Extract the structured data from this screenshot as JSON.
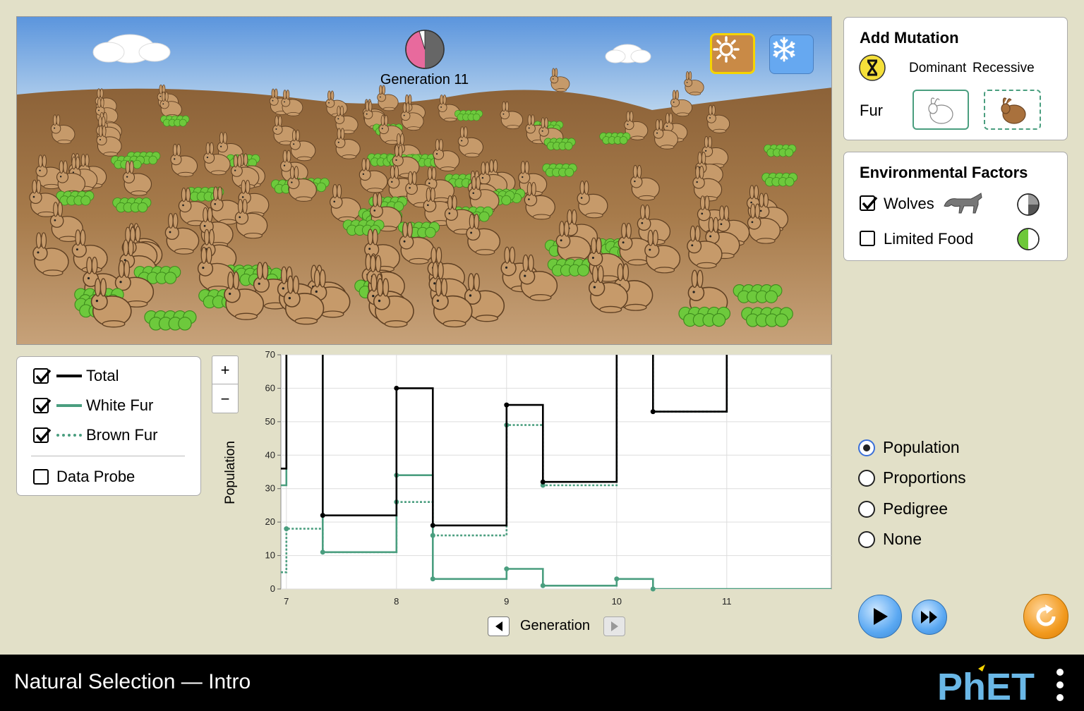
{
  "scene": {
    "generation_label": "Generation 11",
    "pie": {
      "white_fur_fraction": 0.04,
      "brown_fur_fraction": 0.66,
      "wolves_fraction": 0.3
    },
    "environment_buttons": {
      "equator": "sun-icon",
      "arctic": "snowflake-icon",
      "selected": "equator"
    },
    "colors": {
      "sky": "#5b95dd",
      "ground": "#a87a4e",
      "bunny_brown": "#c69a6a",
      "shrub": "#6dc93c",
      "pie_pink": "#e86a9d",
      "pie_gray": "#666666"
    }
  },
  "add_mutation": {
    "title": "Add Mutation",
    "dominant_label": "Dominant",
    "recessive_label": "Recessive",
    "trait_label": "Fur",
    "dominant_option": "white-bunny-icon",
    "recessive_option": "brown-bunny-icon",
    "icon": "dna-hourglass-icon"
  },
  "environmental_factors": {
    "title": "Environmental Factors",
    "wolves_label": "Wolves",
    "wolves_checked": true,
    "limited_food_label": "Limited Food",
    "limited_food_checked": false
  },
  "legend": {
    "total_label": "Total",
    "white_fur_label": "White Fur",
    "brown_fur_label": "Brown Fur",
    "data_probe_label": "Data Probe",
    "total_checked": true,
    "white_checked": true,
    "brown_checked": true,
    "data_probe_checked": false,
    "colors": {
      "total": "#000000",
      "white": "#4a9e7f",
      "brown": "#4a9e7f"
    }
  },
  "zoom": {
    "plus_label": "+",
    "minus_label": "−"
  },
  "graph": {
    "ylabel": "Population",
    "xlabel": "Generation"
  },
  "chart_data": {
    "type": "line",
    "xlabel": "Generation",
    "ylabel": "Population",
    "xlim": [
      6.95,
      11.95
    ],
    "ylim": [
      0,
      70
    ],
    "x_ticks": [
      7,
      8,
      9,
      10,
      11
    ],
    "y_ticks": [
      0,
      10,
      20,
      30,
      40,
      50,
      60,
      70
    ],
    "series": [
      {
        "name": "Total",
        "style": "solid",
        "color": "#000000",
        "points": [
          [
            6.95,
            36
          ],
          [
            7,
            36
          ],
          [
            7,
            80
          ],
          [
            7.33,
            80
          ],
          [
            7.33,
            22
          ],
          [
            8,
            22
          ],
          [
            8,
            60
          ],
          [
            8.33,
            60
          ],
          [
            8.33,
            19
          ],
          [
            9,
            19
          ],
          [
            9,
            55
          ],
          [
            9.33,
            55
          ],
          [
            9.33,
            32
          ],
          [
            10,
            32
          ],
          [
            10,
            80
          ],
          [
            10.33,
            80
          ],
          [
            10.33,
            53
          ],
          [
            11,
            53
          ],
          [
            11,
            80
          ]
        ],
        "markers": [
          [
            7.33,
            22
          ],
          [
            8,
            60
          ],
          [
            8.33,
            19
          ],
          [
            9,
            55
          ],
          [
            9.33,
            32
          ],
          [
            10.33,
            53
          ]
        ]
      },
      {
        "name": "White Fur",
        "style": "solid",
        "color": "#4a9e7f",
        "points": [
          [
            6.95,
            31
          ],
          [
            7,
            31
          ],
          [
            7,
            80
          ],
          [
            7.33,
            80
          ],
          [
            7.33,
            11
          ],
          [
            8,
            11
          ],
          [
            8,
            34
          ],
          [
            8.33,
            34
          ],
          [
            8.33,
            3
          ],
          [
            9,
            3
          ],
          [
            9,
            6
          ],
          [
            9.33,
            6
          ],
          [
            9.33,
            1
          ],
          [
            10,
            1
          ],
          [
            10,
            3
          ],
          [
            10.33,
            3
          ],
          [
            10.33,
            0
          ],
          [
            11.95,
            0
          ]
        ],
        "markers": [
          [
            7.33,
            11
          ],
          [
            8,
            34
          ],
          [
            8.33,
            3
          ],
          [
            9,
            6
          ],
          [
            9.33,
            1
          ],
          [
            10,
            3
          ],
          [
            10.33,
            0
          ]
        ]
      },
      {
        "name": "Brown Fur",
        "style": "dotted",
        "color": "#4a9e7f",
        "points": [
          [
            6.95,
            5
          ],
          [
            7,
            5
          ],
          [
            7,
            18
          ],
          [
            7.33,
            18
          ],
          [
            7.33,
            11
          ],
          [
            8,
            11
          ],
          [
            8,
            26
          ],
          [
            8.33,
            26
          ],
          [
            8.33,
            16
          ],
          [
            9,
            16
          ],
          [
            9,
            49
          ],
          [
            9.33,
            49
          ],
          [
            9.33,
            31
          ],
          [
            10,
            31
          ],
          [
            10,
            80
          ],
          [
            10.33,
            80
          ],
          [
            10.33,
            53
          ],
          [
            11,
            53
          ],
          [
            11,
            80
          ]
        ],
        "markers": [
          [
            7,
            18
          ],
          [
            8,
            26
          ],
          [
            8.33,
            16
          ],
          [
            9,
            49
          ],
          [
            9.33,
            31
          ]
        ]
      }
    ]
  },
  "graph_choice": {
    "options": [
      "Population",
      "Proportions",
      "Pedigree",
      "None"
    ],
    "selected": "Population"
  },
  "navbar": {
    "title": "Natural Selection — Intro",
    "brand": "PhET"
  }
}
